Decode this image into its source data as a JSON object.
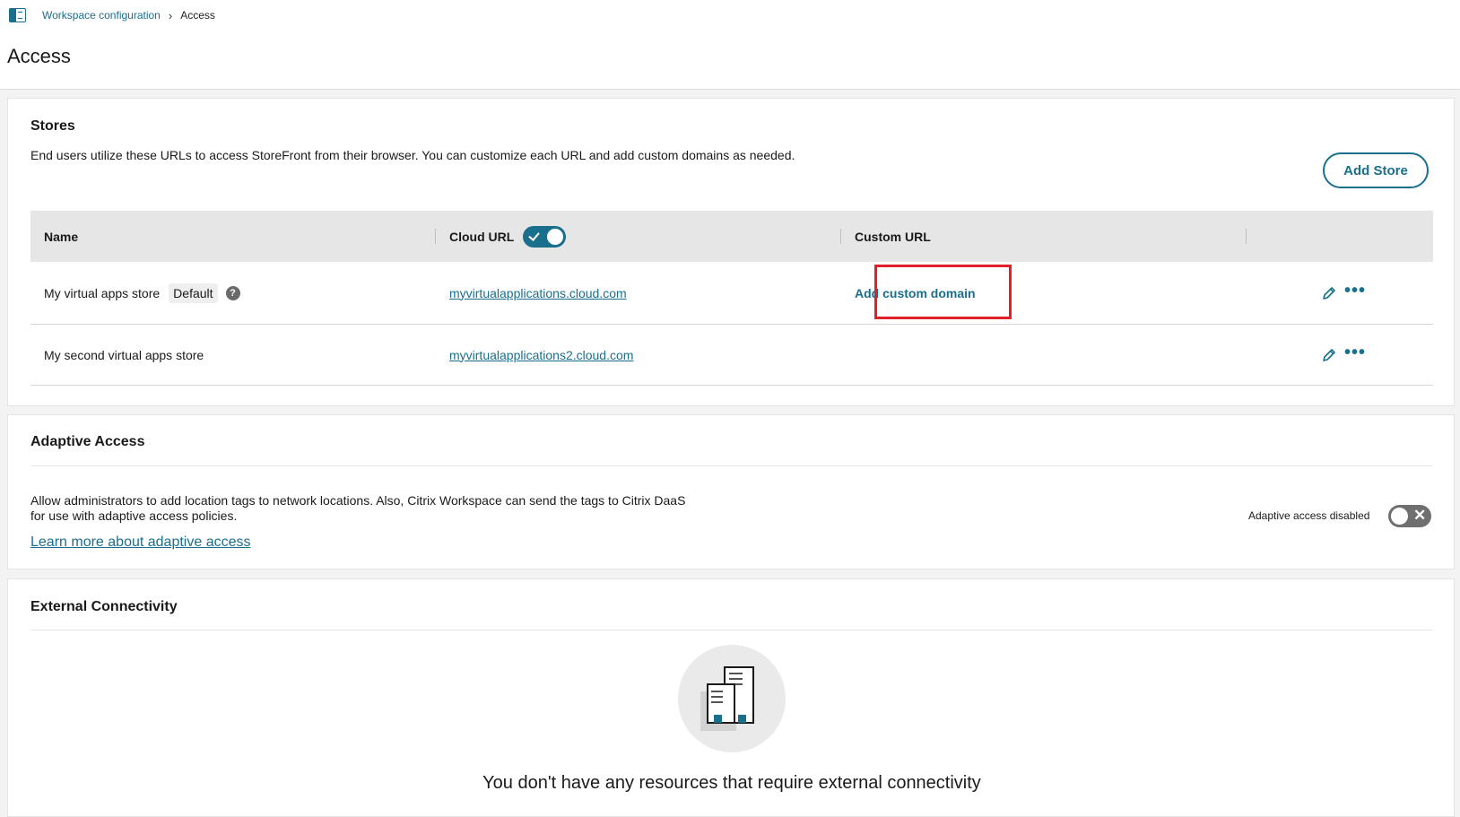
{
  "breadcrumb": {
    "parent": "Workspace configuration",
    "separator": "›",
    "current": "Access"
  },
  "page": {
    "title": "Access"
  },
  "stores": {
    "title": "Stores",
    "description": "End users utilize these URLs to access StoreFront from their browser. You can customize each URL and add custom domains as needed.",
    "add_button": "Add Store",
    "columns": {
      "name": "Name",
      "cloud_url": "Cloud URL",
      "custom_url": "Custom URL"
    },
    "cloud_url_toggle": "on",
    "rows": [
      {
        "name": "My virtual apps store",
        "badge": "Default",
        "cloud_url": "myvirtualapplications.cloud.com",
        "custom_url": "Add custom domain"
      },
      {
        "name": "My second virtual apps store",
        "cloud_url": "myvirtualapplications2.cloud.com"
      }
    ]
  },
  "adaptive": {
    "title": "Adaptive Access",
    "description_line1": "Allow administrators to add location tags to network locations. Also, Citrix Workspace can send the tags to Citrix DaaS",
    "description_line2": "for use with adaptive access policies.",
    "link": "Learn more about adaptive access",
    "status": "Adaptive access disabled",
    "toggle_state": "off"
  },
  "external": {
    "title": "External Connectivity",
    "empty_message": "You don't have any resources that require external connectivity"
  },
  "icons": {
    "panel": "sidebar-toggle-icon",
    "help": "question-mark-icon",
    "edit": "pencil-icon",
    "more": "more-horizontal-icon",
    "empty_state": "server-building-icon"
  },
  "colors": {
    "accent": "#1a6f8c",
    "highlight": "#e1202a",
    "toggle_off": "#6f6f6f",
    "header_row": "#e6e6e6"
  }
}
